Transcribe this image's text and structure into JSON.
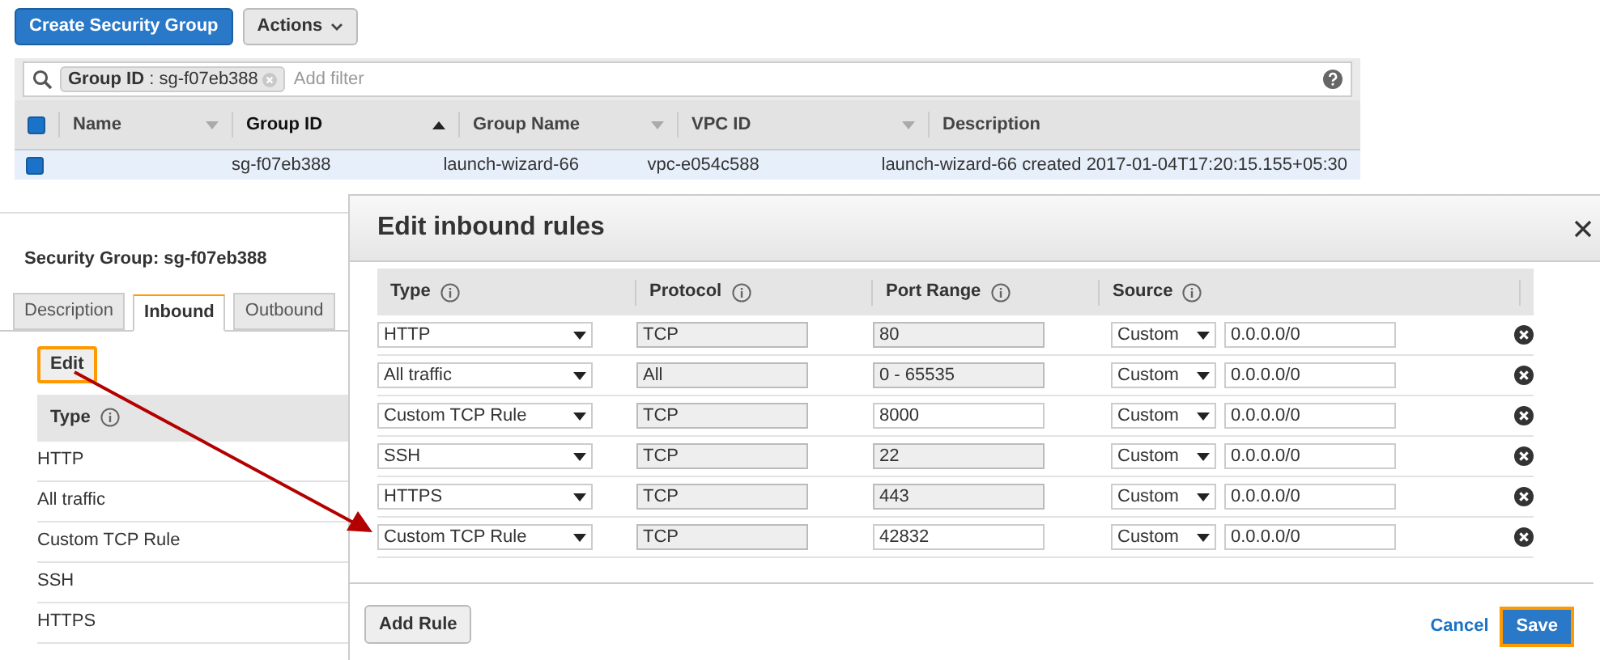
{
  "toolbar": {
    "create_button": "Create Security Group",
    "actions_button": "Actions"
  },
  "filter": {
    "token_key": "Group ID",
    "token_separator": ":",
    "token_value": "sg-f07eb388",
    "placeholder": "Add filter"
  },
  "groups_table": {
    "select_all_checked": true,
    "columns": [
      {
        "label": "Name",
        "sorted": false
      },
      {
        "label": "Group ID",
        "sorted": true
      },
      {
        "label": "Group Name",
        "sorted": false
      },
      {
        "label": "VPC ID",
        "sorted": false
      },
      {
        "label": "Description",
        "sorted": false
      }
    ],
    "rows": [
      {
        "selected": true,
        "checked": true,
        "cells": [
          "",
          "sg-f07eb388",
          "launch-wizard-66",
          "vpc-e054c588",
          "launch-wizard-66 created 2017-01-04T17:20:15.155+05:30"
        ]
      }
    ]
  },
  "details": {
    "title": "Security Group: sg-f07eb388",
    "tabs": [
      {
        "label": "Description",
        "selected": false
      },
      {
        "label": "Inbound",
        "selected": true
      },
      {
        "label": "Outbound",
        "selected": false
      }
    ],
    "edit_button": "Edit",
    "type_header": "Type",
    "types": [
      "HTTP",
      "All traffic",
      "Custom TCP Rule",
      "SSH",
      "HTTPS"
    ]
  },
  "modal": {
    "title": "Edit inbound rules",
    "columns": [
      "Type",
      "Protocol",
      "Port Range",
      "Source"
    ],
    "rules": [
      {
        "type": "HTTP",
        "protocol": "TCP",
        "port": "80",
        "port_disabled": true,
        "source": "Custom",
        "cidr": "0.0.0.0/0"
      },
      {
        "type": "All traffic",
        "protocol": "All",
        "port": "0 - 65535",
        "port_disabled": true,
        "source": "Custom",
        "cidr": "0.0.0.0/0"
      },
      {
        "type": "Custom TCP Rule",
        "protocol": "TCP",
        "port": "8000",
        "port_disabled": false,
        "source": "Custom",
        "cidr": "0.0.0.0/0"
      },
      {
        "type": "SSH",
        "protocol": "TCP",
        "port": "22",
        "port_disabled": true,
        "source": "Custom",
        "cidr": "0.0.0.0/0"
      },
      {
        "type": "HTTPS",
        "protocol": "TCP",
        "port": "443",
        "port_disabled": true,
        "source": "Custom",
        "cidr": "0.0.0.0/0"
      },
      {
        "type": "Custom TCP Rule",
        "protocol": "TCP",
        "port": "42832",
        "port_disabled": false,
        "source": "Custom",
        "cidr": "0.0.0.0/0"
      }
    ],
    "add_button": "Add Rule",
    "cancel_link": "Cancel",
    "save_button": "Save"
  }
}
